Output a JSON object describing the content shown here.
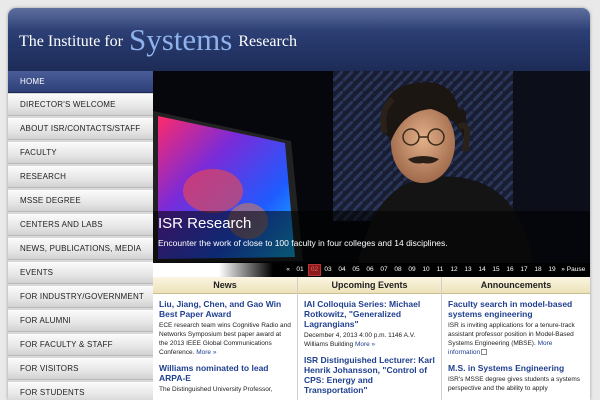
{
  "header": {
    "logo_prefix": "The Institute for",
    "logo_main": "Systems",
    "logo_suffix": "Research"
  },
  "sidebar": {
    "items": [
      {
        "label": "HOME"
      },
      {
        "label": "DIRECTOR'S WELCOME"
      },
      {
        "label": "ABOUT ISR/CONTACTS/STAFF"
      },
      {
        "label": "FACULTY"
      },
      {
        "label": "RESEARCH"
      },
      {
        "label": "MSSE DEGREE"
      },
      {
        "label": "CENTERS AND LABS"
      },
      {
        "label": "NEWS, PUBLICATIONS, MEDIA"
      },
      {
        "label": "EVENTS"
      },
      {
        "label": "FOR INDUSTRY/GOVERNMENT"
      },
      {
        "label": "FOR ALUMNI"
      },
      {
        "label": "FOR FACULTY & STAFF"
      },
      {
        "label": "FOR VISITORS"
      },
      {
        "label": "FOR STUDENTS"
      }
    ]
  },
  "hero": {
    "title": "ISR Research",
    "text": "Encounter the work of close to 100 faculty in four colleges and 14 disciplines."
  },
  "pager": {
    "prev": "«",
    "next": "»",
    "pause": "Pause",
    "pages": [
      "01",
      "02",
      "03",
      "04",
      "05",
      "06",
      "07",
      "08",
      "09",
      "10",
      "11",
      "12",
      "13",
      "14",
      "15",
      "16",
      "17",
      "18",
      "19"
    ],
    "current": "02"
  },
  "news": {
    "heading": "News",
    "items": [
      {
        "title": "Liu, Jiang, Chen, and Gao Win Best Paper Award",
        "text": "ECE research team wins Cognitive Radio and Networks Symposium best paper award at the 2013 IEEE Global Communications Conference.",
        "more": "More »"
      },
      {
        "title": "Williams nominated to lead ARPA-E",
        "text": "The Distinguished University Professor,",
        "more": ""
      }
    ]
  },
  "events": {
    "heading": "Upcoming Events",
    "items": [
      {
        "title": "IAI Colloquia Series: Michael Rotkowitz, \"Generalized Lagrangians\"",
        "text": "December 4, 2013 4:00 p.m. 1146 A.V. Williams Building",
        "more": "More »"
      },
      {
        "title": "ISR Distinguished Lecturer: Karl Henrik Johansson, \"Control of CPS: Energy and Transportation\"",
        "text": "",
        "more": ""
      }
    ]
  },
  "announcements": {
    "heading": "Announcements",
    "items": [
      {
        "title": "Faculty search in model-based systems engineering",
        "text": "ISR is inviting applications for a tenure-track assistant professor position in Model-Based Systems Engineering (MBSE).",
        "more": "More information"
      },
      {
        "title": "M.S. in Systems Engineering",
        "text": "ISR's MSSE degree gives students a systems perspective and the ability to apply",
        "more": ""
      }
    ]
  },
  "colors": {
    "masthead": "#26386b",
    "accent_link": "#1f3f8f",
    "column_header": "#ece1b8",
    "pager_current": "#8c1a1a"
  },
  "icons": {
    "external_link": "external-link-icon"
  }
}
